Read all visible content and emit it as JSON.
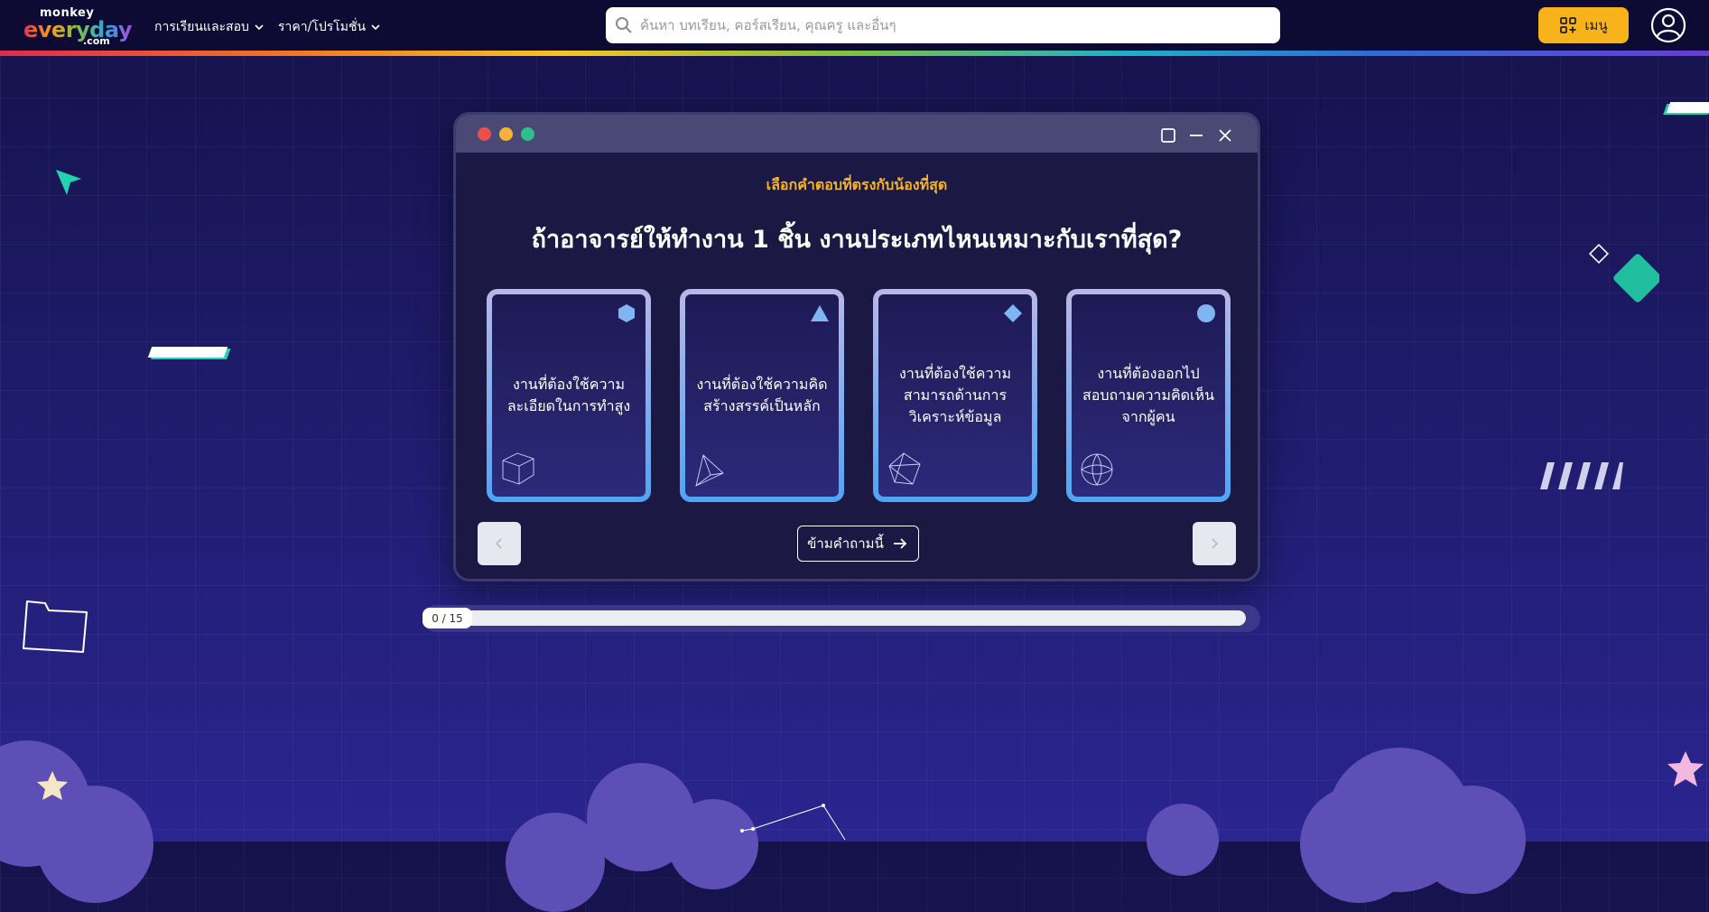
{
  "header": {
    "logo": {
      "line1": "monkey",
      "line2": "everyday",
      "line3": ".com"
    },
    "nav": [
      {
        "label": "การเรียนและสอบ"
      },
      {
        "label": "ราคา/โปรโมชั่น"
      }
    ],
    "search": {
      "placeholder": "ค้นหา บทเรียน, คอร์สเรียน, คุณครู และอื่นๆ"
    },
    "menu_label": "เมนู"
  },
  "quiz": {
    "instruction": "เลือกคำตอบที่ตรงกับน้องที่สุด",
    "question": "ถ้าอาจารย์ให้ทำงาน 1 ชิ้น งานประเภทไหนเหมาะกับเราที่สุด?",
    "options": [
      {
        "text": "งานที่ต้องใช้ความละเอียดในการทำสูง",
        "icon": "hexagon-icon"
      },
      {
        "text": "งานที่ต้องใช้ความคิดสร้างสรรค์เป็นหลัก",
        "icon": "triangle-icon"
      },
      {
        "text": "งานที่ต้องใช้ความสามารถด้านการวิเคราะห์ข้อมูล",
        "icon": "diamond-icon"
      },
      {
        "text": "งานที่ต้องออกไปสอบถามความคิดเห็นจากผู้คน",
        "icon": "circle-icon"
      }
    ],
    "skip_label": "ข้ามคำถามนี้",
    "progress": {
      "current": 0,
      "total": 15,
      "label": "0 / 15"
    }
  },
  "colors": {
    "accent": "#f6b425",
    "header_bg": "#0d0b33",
    "window_bg": "#1b1843",
    "card_border": "#4ea5f4",
    "traffic_red": "#ec4e4e",
    "traffic_yellow": "#f4b43a",
    "traffic_green": "#2fbf8a"
  }
}
